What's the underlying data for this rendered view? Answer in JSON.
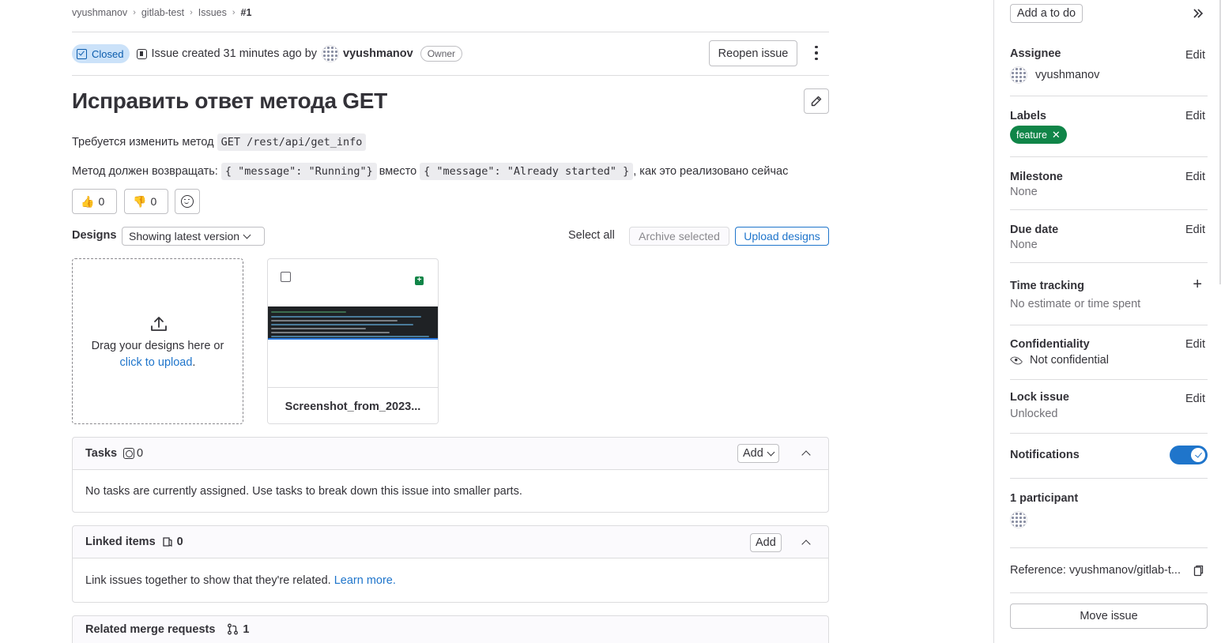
{
  "breadcrumb": {
    "items": [
      "vyushmanov",
      "gitlab-test",
      "Issues"
    ],
    "current": "#1"
  },
  "issue": {
    "status": "Closed",
    "created_text": "Issue created 31 minutes ago by",
    "author": "vyushmanov",
    "author_role": "Owner",
    "reopen_label": "Reopen issue",
    "title": "Исправить ответ метода GET",
    "desc_line1_text": "Требуется изменить метод",
    "desc_line1_code": "GET /rest/api/get_info",
    "desc_line2_pre": "Метод должен возвращать:",
    "desc_line2_code1": "{ \"message\": \"Running\"}",
    "desc_line2_mid": "вместо",
    "desc_line2_code2": "{ \"message\": \"Already started\" }",
    "desc_line2_post": ", как это реализовано сейчас"
  },
  "reactions": {
    "thumbs_up": {
      "emoji": "👍",
      "count": "0"
    },
    "thumbs_down": {
      "emoji": "👎",
      "count": "0"
    }
  },
  "designs": {
    "label": "Designs",
    "version_select": "Showing latest version",
    "select_all": "Select all",
    "archive_selected": "Archive selected",
    "upload": "Upload designs",
    "drop_text": "Drag your designs here or",
    "drop_link": "click to upload",
    "drop_end": ".",
    "card_name": "Screenshot_from_2023..."
  },
  "tasks": {
    "title": "Tasks",
    "count": "0",
    "add": "Add",
    "empty_text": "No tasks are currently assigned. Use tasks to break down this issue into smaller parts."
  },
  "linked": {
    "title": "Linked items",
    "count": "0",
    "add": "Add",
    "text": "Link issues together to show that they're related.",
    "learn_more": "Learn more."
  },
  "related_mr": {
    "title": "Related merge requests",
    "count": "1"
  },
  "sidebar": {
    "todo": "Add a to do",
    "assignee": {
      "title": "Assignee",
      "edit": "Edit",
      "value": "vyushmanov"
    },
    "labels": {
      "title": "Labels",
      "edit": "Edit",
      "value": "feature"
    },
    "milestone": {
      "title": "Milestone",
      "edit": "Edit",
      "value": "None"
    },
    "due_date": {
      "title": "Due date",
      "edit": "Edit",
      "value": "None"
    },
    "time_tracking": {
      "title": "Time tracking",
      "value": "No estimate or time spent"
    },
    "confidentiality": {
      "title": "Confidentiality",
      "edit": "Edit",
      "value": "Not confidential"
    },
    "lock": {
      "title": "Lock issue",
      "edit": "Edit",
      "value": "Unlocked"
    },
    "notifications": {
      "title": "Notifications",
      "enabled": true
    },
    "participants": {
      "title": "1 participant"
    },
    "reference": "Reference: vyushmanov/gitlab-t...",
    "move_issue": "Move issue"
  },
  "colors": {
    "accent": "#1f75cb",
    "label_feature": "#108548",
    "closed_badge": "#cbe2f9"
  }
}
